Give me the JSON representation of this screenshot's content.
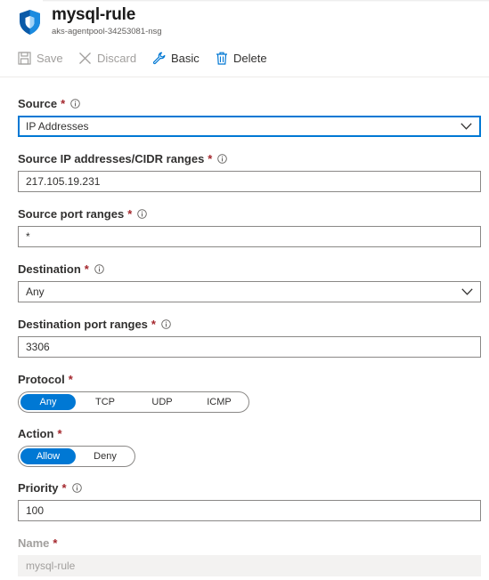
{
  "header": {
    "title": "mysql-rule",
    "subtitle": "aks-agentpool-34253081-nsg"
  },
  "toolbar": {
    "save_label": "Save",
    "discard_label": "Discard",
    "basic_label": "Basic",
    "delete_label": "Delete"
  },
  "form": {
    "source": {
      "label": "Source",
      "required": "*",
      "value": "IP Addresses"
    },
    "source_ips": {
      "label": "Source IP addresses/CIDR ranges",
      "required": "*",
      "value": "217.105.19.231"
    },
    "source_ports": {
      "label": "Source port ranges",
      "required": "*",
      "value": "*"
    },
    "destination": {
      "label": "Destination",
      "required": "*",
      "value": "Any"
    },
    "destination_ports": {
      "label": "Destination port ranges",
      "required": "*",
      "value": "3306"
    },
    "protocol": {
      "label": "Protocol",
      "required": "*",
      "options": [
        "Any",
        "TCP",
        "UDP",
        "ICMP"
      ],
      "selected": "Any"
    },
    "action": {
      "label": "Action",
      "required": "*",
      "options": [
        "Allow",
        "Deny"
      ],
      "selected": "Allow"
    },
    "priority": {
      "label": "Priority",
      "required": "*",
      "value": "100"
    },
    "name": {
      "label": "Name",
      "required": "*",
      "value": "mysql-rule"
    }
  },
  "colors": {
    "accent": "#0078d4",
    "required": "#a4262c",
    "disabled_text": "#a19f9d"
  },
  "icons": {
    "header": "shield-icon",
    "save": "save-icon",
    "discard": "close-icon",
    "basic": "wrench-icon",
    "delete": "trash-icon",
    "info": "info-icon",
    "dropdown": "chevron-down-icon"
  }
}
